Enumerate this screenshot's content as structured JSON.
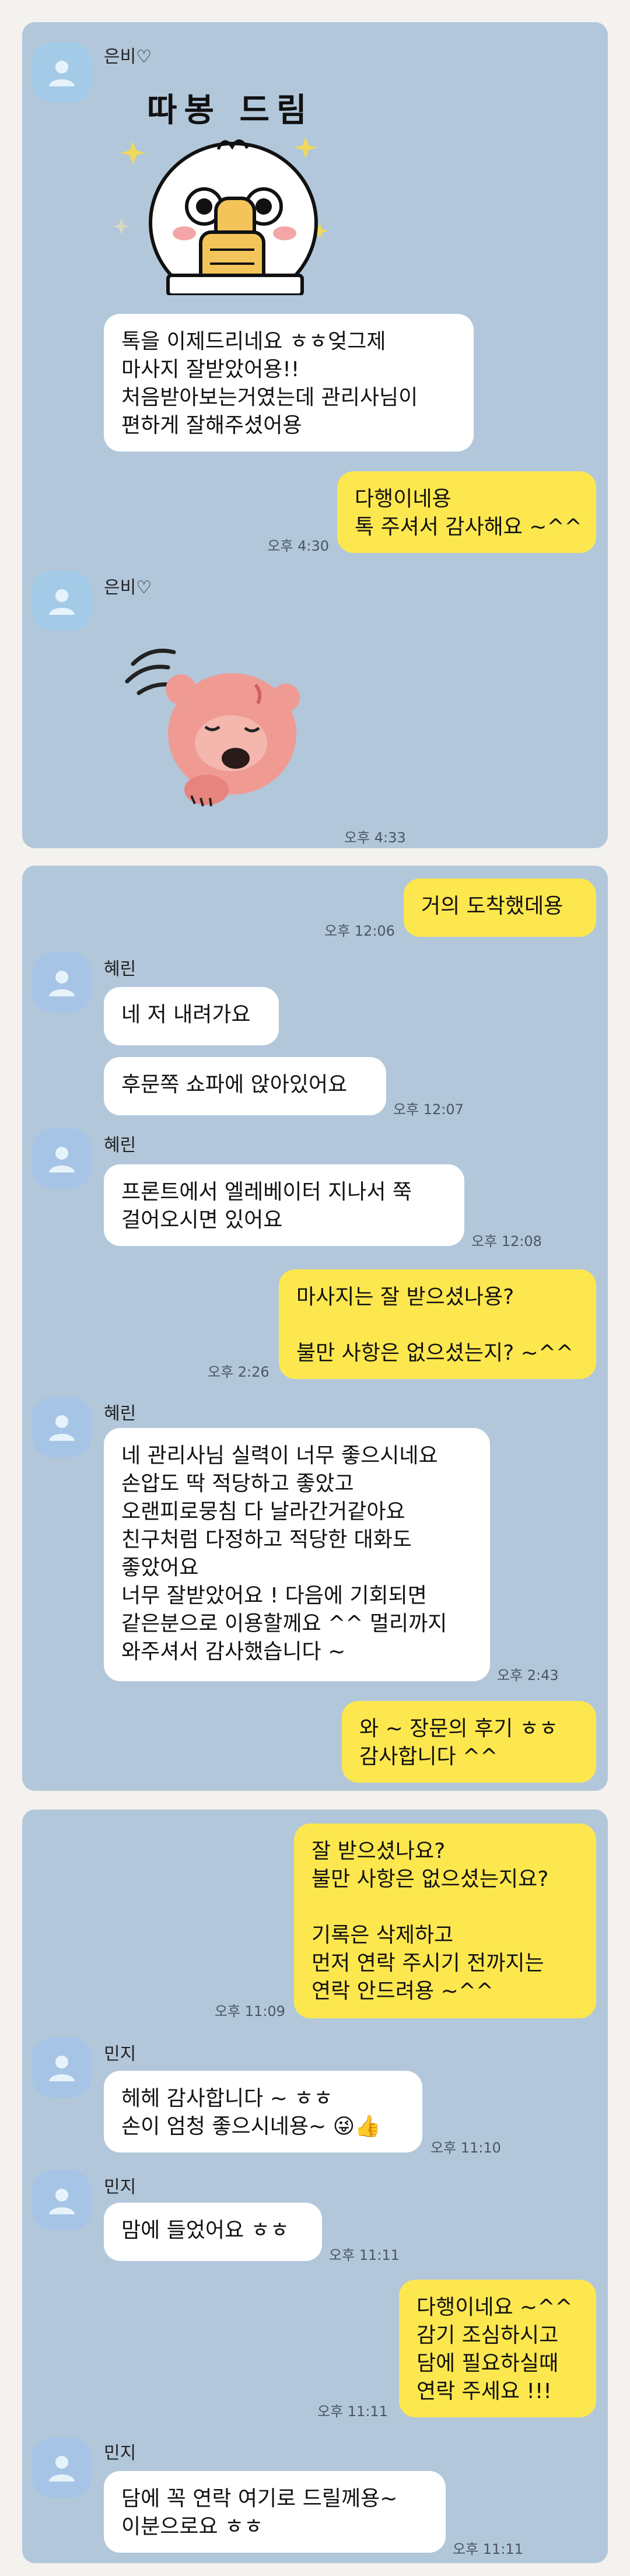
{
  "chats": [
    {
      "messages": [
        {
          "sender": "은비♡"
        },
        {
          "sticker_text": "따봉 드림"
        },
        {
          "lines": [
            "톡을 이제드리네요 ㅎㅎ엊그제",
            "마사지 잘받았어용!!",
            "처음받아보는거였는데 관리사님이",
            "편하게 잘해주셨어용"
          ]
        },
        {
          "lines": [
            "다행이네용",
            "톡 주셔서 감사해요 ~^^"
          ],
          "time": "오후 4:30"
        },
        {
          "sender": "은비♡",
          "time": "오후 4:33"
        }
      ]
    },
    {
      "messages": [
        {
          "lines": [
            "거의 도착했데용"
          ],
          "time": "오후 12:06"
        },
        {
          "sender": "혜린",
          "lines": [
            "네 저 내려가요"
          ]
        },
        {
          "lines": [
            "후문쪽 쇼파에 앉아있어요"
          ],
          "time": "오후 12:07"
        },
        {
          "sender": "혜린",
          "lines": [
            "프론트에서 엘레베이터 지나서 쭉",
            "걸어오시면 있어요"
          ],
          "time": "오후 12:08"
        },
        {
          "lines": [
            "마사지는 잘 받으셨나용?",
            "",
            "불만 사항은 없으셨는지? ~^^"
          ],
          "time": "오후 2:26"
        },
        {
          "sender": "혜린",
          "lines": [
            "네 관리사님 실력이 너무 좋으시네요",
            "손압도 딱 적당하고 좋았고",
            "오랜피로뭉침 다 날라간거같아요",
            "친구처럼 다정하고 적당한 대화도",
            "좋았어요",
            "너무 잘받았어요 ! 다음에 기회되면",
            "같은분으로 이용할께요 ^^ 멀리까지",
            "와주셔서 감사했습니다 ~"
          ],
          "time": "오후 2:43"
        },
        {
          "lines": [
            "와 ~ 장문의 후기 ㅎㅎ",
            "감사합니다 ^^"
          ]
        }
      ]
    },
    {
      "messages": [
        {
          "lines": [
            "잘 받으셨나요?",
            "불만 사항은 없으셨는지요?",
            "",
            "기록은 삭제하고",
            "먼저 연락 주시기 전까지는",
            "연락 안드려용 ~^^"
          ],
          "time": "오후 11:09"
        },
        {
          "sender": "민지",
          "lines": [
            "헤헤 감사합니다 ~ ㅎㅎ",
            "손이 엄청 좋으시네용~ 😜👍"
          ],
          "time": "오후 11:10"
        },
        {
          "sender": "민지",
          "lines": [
            "맘에 들었어요 ㅎㅎ"
          ],
          "time": "오후 11:11"
        },
        {
          "lines": [
            "다행이네요 ~^^",
            "감기 조심하시고",
            "담에 필요하실때",
            "연락 주세요 !!!"
          ],
          "time": "오후 11:11"
        },
        {
          "sender": "민지",
          "lines": [
            "담에 꼭 연락 여기로 드릴께용~",
            "이분으로요 ㅎㅎ"
          ],
          "time": "오후 11:11"
        }
      ]
    }
  ],
  "colors": {
    "chat_bg": "#b2c7da",
    "outgoing_bubble": "#fde74e",
    "incoming_bubble": "#ffffff",
    "avatar": "#a3cbe8",
    "page_bg": "#f4f2ee"
  },
  "icons": {
    "avatar": "default-profile-icon"
  }
}
